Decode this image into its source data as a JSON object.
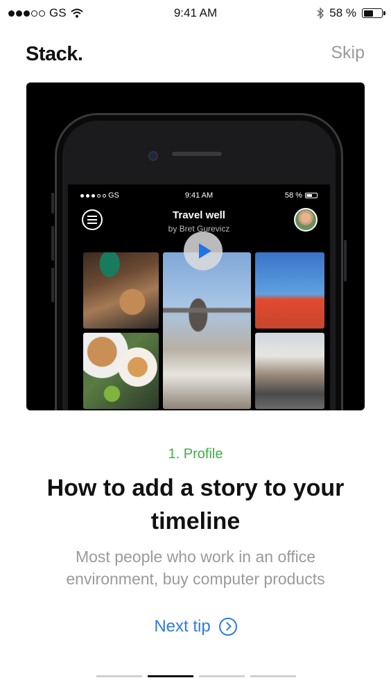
{
  "status_bar": {
    "carrier": "GS",
    "time": "9:41 AM",
    "battery_text": "58 %",
    "battery_level": 0.58
  },
  "header": {
    "logo": "Stack.",
    "skip_label": "Skip"
  },
  "preview": {
    "status_carrier": "GS",
    "status_time": "9:41 AM",
    "status_battery": "58 %",
    "title": "Travel well",
    "subtitle": "by Bret Gurevicz",
    "icons": [
      "menu-icon",
      "play-icon",
      "avatar"
    ]
  },
  "content": {
    "step_label": "1. Profile",
    "headline": "How to add a story to your timeline",
    "description": "Most people who work in an office environment, buy computer products",
    "next_label": "Next tip"
  },
  "pager": {
    "pages": 4,
    "active_index": 1
  },
  "colors": {
    "accent": "#2d7be5",
    "step_green": "#3cb043",
    "muted": "#9a9a9a"
  }
}
